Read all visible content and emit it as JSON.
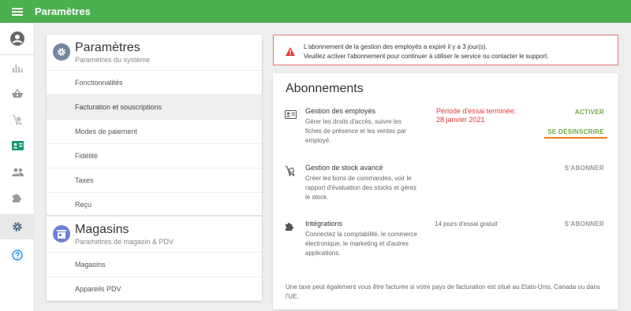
{
  "header": {
    "title": "Paramètres",
    "menu_icon": "hamburger-icon",
    "bg_color": "#4caf50"
  },
  "rail": {
    "icons": [
      "account-icon",
      "bar-chart-icon",
      "basket-icon",
      "cart-icon",
      "id-card-icon",
      "people-icon",
      "puzzle-icon",
      "gear-icon",
      "help-icon"
    ],
    "active": "gear-icon"
  },
  "settings_section": {
    "title": "Paramètres",
    "subtitle": "Paramètres du système",
    "items": [
      {
        "label": "Fonctionnalités"
      },
      {
        "label": "Facturation et souscriptions",
        "selected": true
      },
      {
        "label": "Modes de paiement"
      },
      {
        "label": "Fidélité"
      },
      {
        "label": "Taxes"
      },
      {
        "label": "Reçu"
      }
    ]
  },
  "stores_section": {
    "title": "Magasins",
    "subtitle": "Paramètres de magasin & PDV",
    "items": [
      {
        "label": "Magasins"
      },
      {
        "label": "Appareils PDV"
      }
    ]
  },
  "alert": {
    "line1": "L'abonnement de la gestion des employés a expiré il y a 3 jour(s).",
    "line2": "Veuillez activer l'abonnement pour continuer à utiliser le service ou contacter le support.",
    "border_color": "#e57373",
    "icon_color": "#e53935"
  },
  "subscriptions": {
    "title": "Abonnements",
    "items": [
      {
        "name": "Gestion des employés",
        "description": "Gérer les droits d'accès, suivre les fiches de présence et les ventes par employé.",
        "status_line1": "Période d'essai terminée:",
        "status_line2": "28 janvier 2021",
        "primary_action": "ACTIVER",
        "secondary_action": "SE DÉSINSCRIRE",
        "icon": "id-card-icon"
      },
      {
        "name": "Gestion de stock avancé",
        "description": "Créer les bons de commandes, voir le rapport d'évaluation des stocks et gérez le stock.",
        "action": "S'ABONNER",
        "icon": "cart-icon"
      },
      {
        "name": "Intégrations",
        "description": "Connectez la comptabilité, le commerce électronique, le marketing et d'autres applications.",
        "status": "14 jours d'essai gratuit",
        "action": "S'ABONNER",
        "icon": "puzzle-icon"
      }
    ],
    "footnote": "Une taxe peut également vous être facturée si votre pays de facturation est situé au Etats-Unis, Canada ou dans l'UE."
  },
  "colors": {
    "accent_green": "#6aaa3d",
    "accent_orange": "#ee7d1d",
    "error_red": "#e53935"
  }
}
